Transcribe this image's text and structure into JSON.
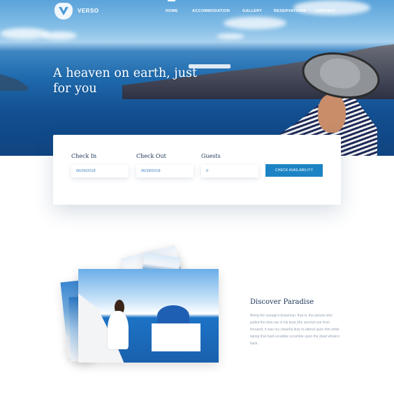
{
  "brand": {
    "name": "VERSO",
    "logo_icon": "v-shield-icon"
  },
  "nav": {
    "items": [
      {
        "label": "HOME",
        "active": true
      },
      {
        "label": "ACCOMMODATION",
        "active": false
      },
      {
        "label": "GALLERY",
        "active": false
      },
      {
        "label": "RESERVATIONS",
        "active": false
      },
      {
        "label": "CONTACT",
        "active": false
      }
    ]
  },
  "hero": {
    "title": "A heaven on earth, just for you"
  },
  "booking": {
    "check_in": {
      "label": "Check In",
      "value": "06/26/2018"
    },
    "check_out": {
      "label": "Check Out",
      "value": "06/28/2018"
    },
    "guests": {
      "label": "Guests",
      "value": "0"
    },
    "button_label": "CHECK AVAILABILITY"
  },
  "discover": {
    "title": "Discover Paradise",
    "text": "Being the savage's bowsman, that is, the person who pulled the bow-oar in his boat (the second one from forward), it was my cheerful duty to attend upon him while taking that hard-scrabble scramble upon the dead whale's back."
  },
  "colors": {
    "accent": "#1c84c4",
    "heading": "#1a3558",
    "body_text": "#9aa6b6"
  }
}
